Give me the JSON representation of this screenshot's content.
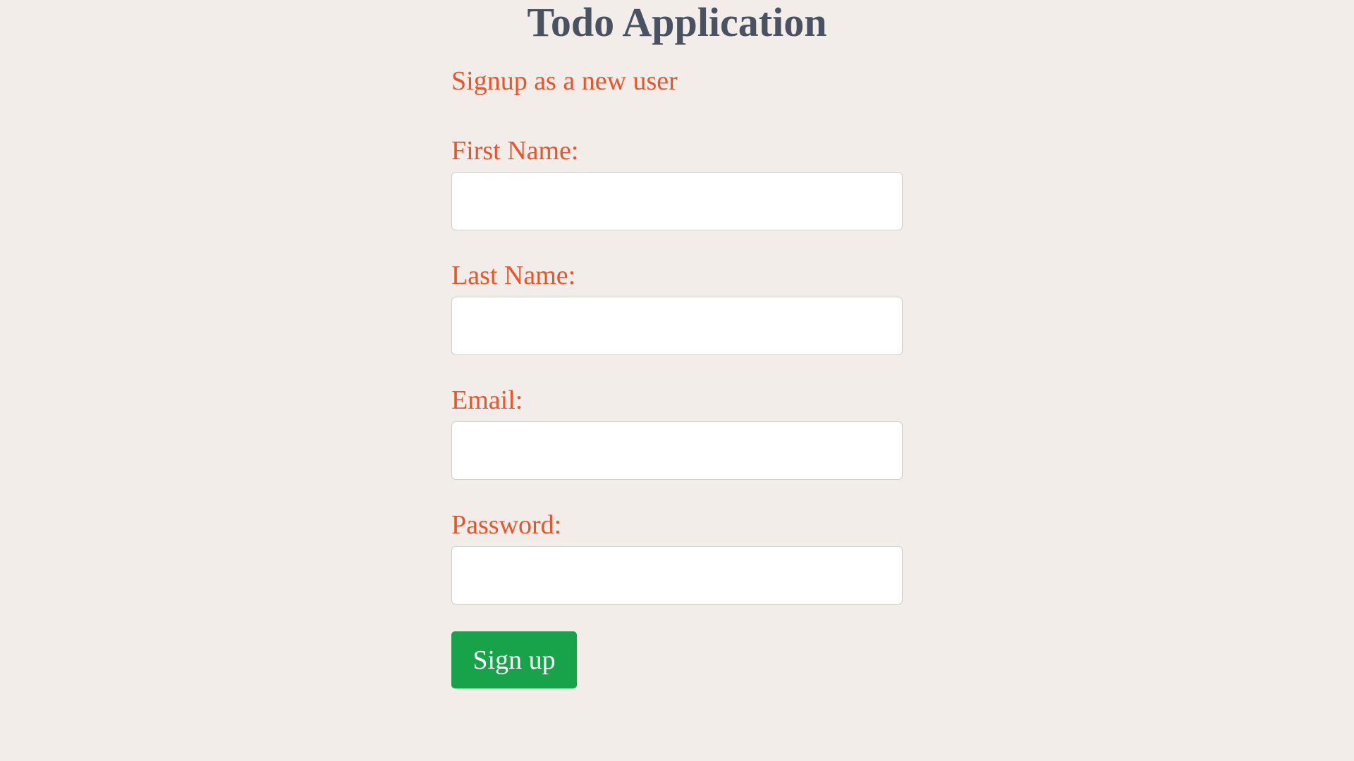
{
  "app": {
    "title": "Todo Application"
  },
  "form": {
    "subtitle": "Signup as a new user",
    "fields": [
      {
        "label": "First Name:",
        "value": "",
        "placeholder": ""
      },
      {
        "label": "Last Name:",
        "value": "",
        "placeholder": ""
      },
      {
        "label": "Email:",
        "value": "",
        "placeholder": ""
      },
      {
        "label": "Password:",
        "value": "",
        "placeholder": ""
      }
    ],
    "submit_label": "Sign up"
  },
  "colors": {
    "background": "#f2ede8",
    "title": "#4a5262",
    "accent": "#e8552d",
    "button": "#18a34a"
  }
}
